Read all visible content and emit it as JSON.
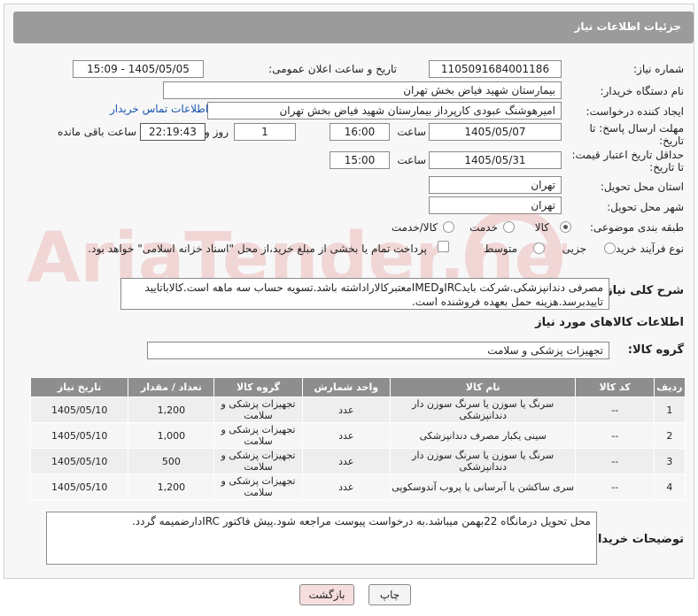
{
  "header": {
    "title": "جزئیات اطلاعات نیاز"
  },
  "fields": {
    "need_number_label": "شماره نیاز:",
    "need_number": "1105091684001186",
    "announce_label": "تاریخ و ساعت اعلان عمومی:",
    "announce_value": "1405/05/05 - 15:09",
    "buyer_label": "نام دستگاه خریدار:",
    "buyer_value": "بیمارستان شهید فیاض بخش تهران",
    "creator_label": "ایجاد کننده درخواست:",
    "creator_value": "امیرهوشنگ عبودی کارپرداز بیمارستان شهید فیاض بخش تهران",
    "contact_link": "اطلاعات تماس خریدار",
    "deadline_label_1": "مهلت ارسال پاسخ: تا",
    "deadline_label_2": "تاریخ:",
    "deadline_date": "1405/05/07",
    "time_label": "ساعت",
    "deadline_time": "16:00",
    "days_value": "1",
    "days_label": "روز و",
    "remaining_time": "22:19:43",
    "remaining_label": "ساعت باقی مانده",
    "min_validity_label_1": "حداقل تاریخ اعتبار قیمت:",
    "min_validity_label_2": "تا تاریخ:",
    "validity_date": "1405/05/31",
    "validity_time": "15:00",
    "province_label": "استان محل تحویل:",
    "province_value": "تهران",
    "city_label": "شهر محل تحویل:",
    "city_value": "تهران",
    "category_label": "طبقه بندی موضوعی:",
    "category_options": [
      "کالا",
      "خدمت",
      "کالا/خدمت"
    ],
    "process_label": "نوع فرآیند خرید :",
    "process_options": [
      "جزیی",
      "متوسط"
    ],
    "payment_note": "پرداخت تمام یا بخشی از مبلغ خرید،از محل \"اسناد خزانه اسلامی\" خواهد بود.",
    "summary_label": "شرح کلی نیاز:",
    "summary_value": "مصرفی دندانپزشکی.شرکت بایدIRCوIMEDمعتبرکالاراداشته باشد.تسویه حساب سه ماهه است.کالاباتایید\nتاییدبرسد.هزینه حمل بعهده فروشنده است.",
    "goods_info_title": "اطلاعات کالاهای مورد نیاز",
    "goods_group_label": "گروه کالا:",
    "goods_group_value": "تجهیزات پزشکی و سلامت",
    "buyer_notes_label": "توضیحات خریدار:",
    "buyer_notes_value": "محل تحویل درمانگاه 22بهمن میباشد.به درخواست پیوست مراجعه شود.پیش فاکتور IRCدارضمیمه گردد."
  },
  "table": {
    "headers": [
      "ردیف",
      "کد کالا",
      "نام کالا",
      "واحد شمارش",
      "گروه کالا",
      "تعداد / مقدار",
      "تاریخ نیاز"
    ],
    "rows": [
      [
        "1",
        "--",
        "سرنگ یا سوزن یا سرنگ سوزن دار دندانپزشکی",
        "عدد",
        "تجهیزات پزشکی و سلامت",
        "1,200",
        "1405/05/10"
      ],
      [
        "2",
        "--",
        "سینی یکبار مصرف دندانپزشکی",
        "عدد",
        "تجهیزات پزشکی و سلامت",
        "1,000",
        "1405/05/10"
      ],
      [
        "3",
        "--",
        "سرنگ یا سوزن یا سرنگ سوزن دار دندانپزشکی",
        "عدد",
        "تجهیزات پزشکی و سلامت",
        "500",
        "1405/05/10"
      ],
      [
        "4",
        "--",
        "سری ساکشن یا آبرسانی یا پروب آندوسکوپی",
        "عدد",
        "تجهیزات پزشکی و سلامت",
        "1,200",
        "1405/05/10"
      ]
    ]
  },
  "buttons": {
    "print": "چاپ",
    "back": "بازگشت"
  },
  "watermark": {
    "text": "AriaTender.net"
  },
  "colors": {
    "header_bg": "#9b9b9b",
    "table_header_bg": "#8e8e8e",
    "back_button_bg": "#f7dede",
    "link": "#1a55b0"
  }
}
